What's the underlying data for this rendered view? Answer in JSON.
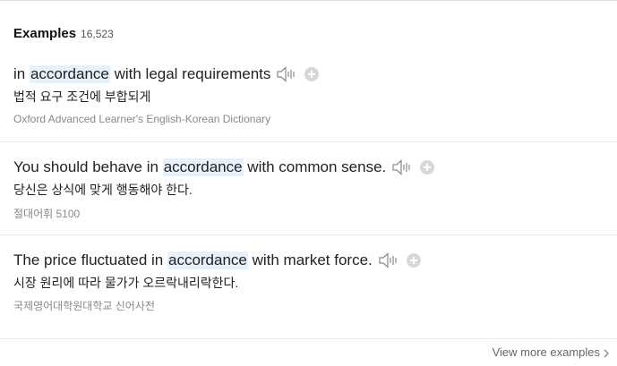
{
  "header": {
    "title": "Examples",
    "count": "16,523"
  },
  "examples": [
    {
      "before": "in ",
      "highlight": "accordance",
      "after": " with legal requirements",
      "translation": "법적 요구 조건에 부합되게",
      "source": "Oxford Advanced Learner's English-Korean Dictionary"
    },
    {
      "before": "You should behave in ",
      "highlight": "accordance",
      "after": " with common sense.",
      "translation": "당신은 상식에 맞게 행동해야 한다.",
      "source": "절대어휘 5100"
    },
    {
      "before": "The price fluctuated in ",
      "highlight": "accordance",
      "after": " with market force.",
      "translation": "시장 원리에 따라 물가가 오르락내리락한다.",
      "source": "국제영어대학원대학교 신어사전"
    }
  ],
  "footer": {
    "view_more": "View more examples"
  },
  "icons": {
    "speaker": "speaker-icon",
    "add": "plus-circle-icon",
    "more": "chevron-right-icon"
  },
  "colors": {
    "highlight": "#e6f1fc",
    "icon_gray": "#999999"
  }
}
